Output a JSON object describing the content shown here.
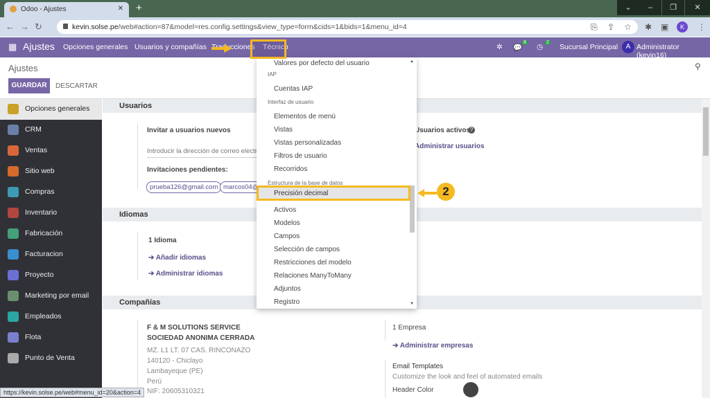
{
  "browser": {
    "tab_title": "Odoo - Ajustes",
    "url_host": "kevin.solse.pe",
    "url_path": "/web#action=87&model=res.config.settings&view_type=form&cids=1&bids=1&menu_id=4",
    "profile_initial": "K",
    "status_url": "https://kevin.solse.pe/web#menu_id=20&action=4"
  },
  "navbar": {
    "app": "Ajustes",
    "menus": [
      "Opciones generales",
      "Usuarios y compañías",
      "Traducciones",
      "Técnico"
    ],
    "messages_count": "8",
    "activities_count": "2",
    "branch": "Sucursal Principal",
    "user_initial": "A",
    "user": "Administrator (kevin16)"
  },
  "control": {
    "title": "Ajustes",
    "save": "GUARDAR",
    "discard": "DESCARTAR"
  },
  "sidebar": [
    "Opciones generales",
    "CRM",
    "Ventas",
    "Sitio web",
    "Compras",
    "Inventario",
    "Fabricación",
    "Facturacion",
    "Proyecto",
    "Marketing por email",
    "Empleados",
    "Flota",
    "Punto de Venta"
  ],
  "sidebar_colors": [
    "#c9a227",
    "#6a7fa8",
    "#d9663a",
    "#d66a2b",
    "#3d9ab5",
    "#b0463f",
    "#43a07a",
    "#3a8fd0",
    "#6a6fd3",
    "#6b8f6e",
    "#2ba6a0",
    "#7b7fd0",
    "#aaa"
  ],
  "users": {
    "heading": "Usuarios",
    "invite": "Invitar a usuarios nuevos",
    "invite_placeholder": "Introducir la dirección de correo electrónico",
    "pending": "Invitaciones pendientes:",
    "chips": [
      "prueba126@gmail.com",
      "marcos04@"
    ],
    "active": "Usuarios activos",
    "manage": "Administrar usuarios"
  },
  "languages": {
    "heading": "Idiomas",
    "count": "1 Idioma",
    "add": "Añadir idiomas",
    "manage": "Administrar idiomas"
  },
  "companies": {
    "heading": "Compañías",
    "name1": "F & M SOLUTIONS SERVICE",
    "name2": "SOCIEDAD ANONIMA CERRADA",
    "address": [
      "MZ. L1 LT. 07 CAS. RINCONAZO",
      "140120 - Chiclayo",
      "Lambayeque (PE)",
      "Perú",
      "NIF:  20605310321"
    ],
    "count": "1 Empresa",
    "manage": "Administrar empresas",
    "email_title": "Email Templates",
    "email_desc": "Customize the look and feel of automated emails",
    "header_color": "Header Color"
  },
  "dropdown": {
    "top_partial": "Valores por defecto del usuario",
    "groups": [
      {
        "header": "IAP",
        "items": [
          "Cuentas IAP"
        ]
      },
      {
        "header": "Interfaz de usuario",
        "items": [
          "Elementos de menú",
          "Vistas",
          "Vistas personalizadas",
          "Filtros de usuario",
          "Recorridos"
        ]
      },
      {
        "header": "Estructura de la base de datos",
        "items": [
          "Precisión decimal",
          "Activos",
          "Modelos",
          "Campos",
          "Selección de campos",
          "Restricciones del modelo",
          "Relaciones ManyToMany",
          "Adjuntos",
          "Registro"
        ]
      }
    ]
  },
  "annotation": {
    "step": "2",
    "highlight_color": "#f5b921"
  }
}
